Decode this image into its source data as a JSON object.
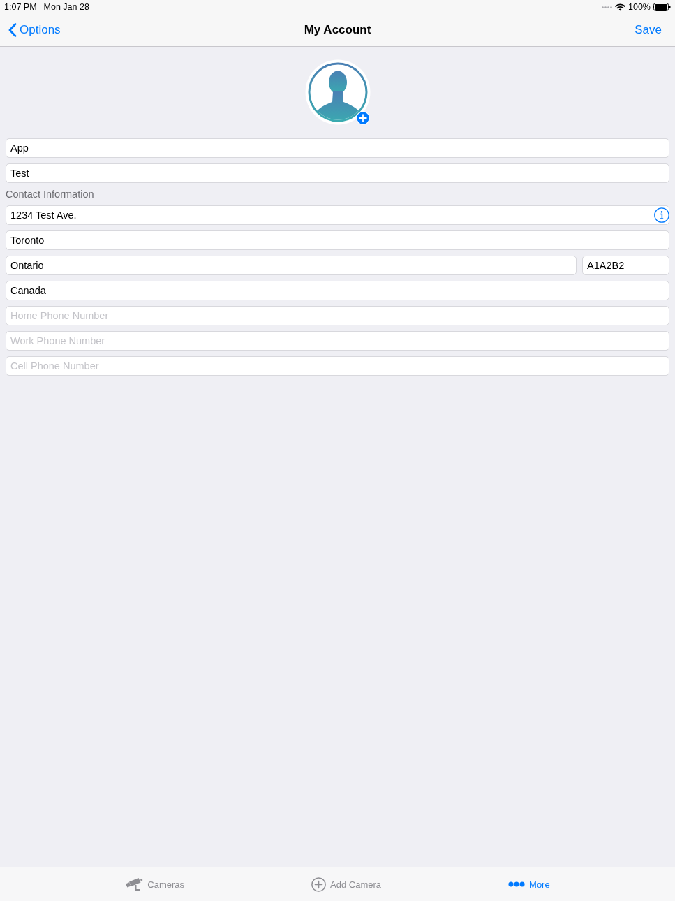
{
  "status_bar": {
    "time": "1:07 PM",
    "date": "Mon Jan 28",
    "battery_text": "100%"
  },
  "nav_bar": {
    "back_label": "Options",
    "title": "My Account",
    "action_label": "Save"
  },
  "name_fields": [
    {
      "value": "App",
      "info": false
    },
    {
      "value": "Test",
      "info": false
    }
  ],
  "contact_section": {
    "title": "Contact Information",
    "rows": [
      [
        {
          "value": "1234 Test Ave.",
          "info": true
        }
      ],
      [
        {
          "value": "Toronto",
          "info": false
        }
      ],
      [
        {
          "value": "Ontario",
          "info": false
        },
        {
          "value": "A1A2B2",
          "info": false
        }
      ],
      [
        {
          "value": "Canada",
          "info": false
        }
      ],
      [
        {
          "placeholder": "Home Phone Number",
          "info": false
        }
      ],
      [
        {
          "placeholder": "Work Phone Number",
          "info": false
        }
      ],
      [
        {
          "placeholder": "Cell Phone Number",
          "info": false
        }
      ]
    ]
  },
  "tab_bar": {
    "tabs": [
      {
        "label": "Cameras",
        "selected": false
      },
      {
        "label": "Add Camera",
        "selected": false
      },
      {
        "label": "More",
        "selected": true
      }
    ]
  }
}
